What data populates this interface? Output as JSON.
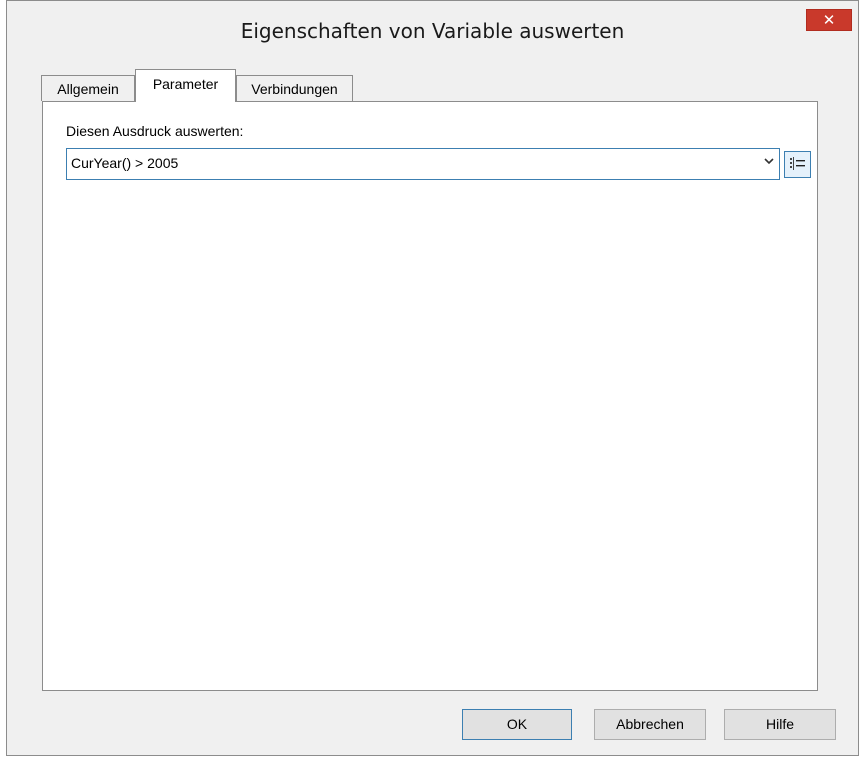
{
  "window": {
    "title": "Eigenschaften von Variable auswerten",
    "close_glyph": "✕"
  },
  "tabs": [
    {
      "label": "Allgemein",
      "selected": false
    },
    {
      "label": "Parameter",
      "selected": true
    },
    {
      "label": "Verbindungen",
      "selected": false
    }
  ],
  "parameter": {
    "expression_label": "Diesen Ausdruck auswerten:",
    "expression_value": "CurYear() > 2005",
    "dropdown_icon": "chevron-down-icon",
    "wizard_icon": "formula-list-icon"
  },
  "buttons": {
    "ok": "OK",
    "cancel": "Abbrechen",
    "help": "Hilfe"
  },
  "colors": {
    "close_button": "#c9392b",
    "focus_border": "#3c7fb1",
    "dialog_background": "#f0f0f0"
  }
}
